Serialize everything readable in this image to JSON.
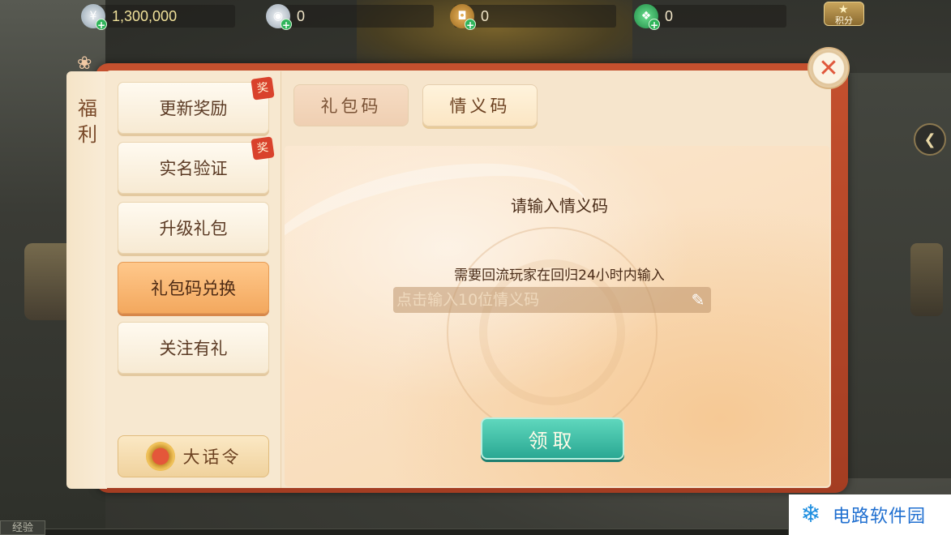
{
  "resources": [
    {
      "icon": "ingot-coin-icon",
      "value": "1,300,000"
    },
    {
      "icon": "silver-ingot-icon",
      "value": "0"
    },
    {
      "icon": "copper-coin-icon",
      "value": "0"
    },
    {
      "icon": "jade-icon",
      "value": "0"
    }
  ],
  "jifen_label": "积分",
  "side_label": "福利",
  "menu": {
    "items": [
      {
        "label": "更新奖励",
        "badge": "奖"
      },
      {
        "label": "实名验证",
        "badge": "奖"
      },
      {
        "label": "升级礼包"
      },
      {
        "label": "礼包码兑换",
        "active": true
      },
      {
        "label": "关注有礼"
      }
    ],
    "dahua_label": "大话令"
  },
  "tabs": [
    {
      "label": "礼包码"
    },
    {
      "label": "情义码",
      "active": true
    }
  ],
  "content": {
    "title": "请输入情义码",
    "subtitle": "需要回流玩家在回归24小时内输入",
    "input_placeholder": "点击输入10位情义码",
    "claim_label": "领取"
  },
  "bottom": {
    "exp_label": "经验"
  },
  "watermark": {
    "text": "电路软件园"
  },
  "colors": {
    "panel_frame": "#c4502e",
    "active_menu": "#f3a85e",
    "claim_button": "#2aa893",
    "close_icon": "#e0583c"
  }
}
